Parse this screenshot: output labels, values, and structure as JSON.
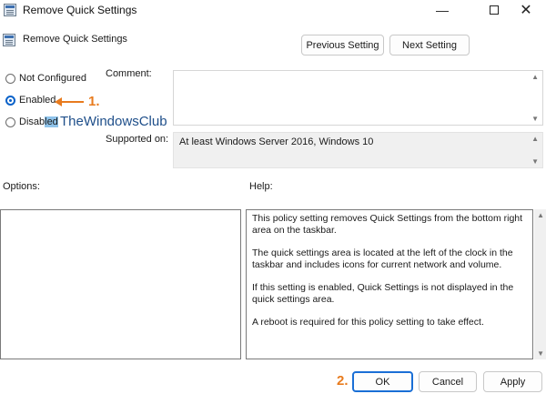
{
  "window": {
    "title": "Remove Quick Settings",
    "minimize_glyph": "—",
    "close_glyph": "✕"
  },
  "header": {
    "policy_name": "Remove Quick Settings",
    "previous_label": "Previous Setting",
    "next_label": "Next Setting"
  },
  "state": {
    "options": [
      {
        "label": "Not Configured",
        "checked": false
      },
      {
        "label": "Enabled",
        "checked": true
      },
      {
        "label_prefix": "Disab",
        "label_highlight": "led",
        "checked": false
      }
    ]
  },
  "annotations": {
    "step1": "1.",
    "step2": "2.",
    "watermark": "TheWindowsClub",
    "accent_color": "#e87b1e"
  },
  "comment": {
    "label": "Comment:",
    "value": ""
  },
  "supported": {
    "label": "Supported on:",
    "value": "At least Windows Server 2016, Windows 10"
  },
  "options_panel": {
    "label": "Options:"
  },
  "help": {
    "label": "Help:",
    "paragraphs": [
      "This policy setting removes Quick Settings from the bottom right area on the taskbar.",
      "The quick settings area is located at the left of the clock in the taskbar and includes icons for current network and volume.",
      "If this setting is enabled, Quick Settings is not displayed in the quick settings area.",
      "A reboot is required for this policy setting to take effect."
    ]
  },
  "footer": {
    "ok_label": "OK",
    "cancel_label": "Cancel",
    "apply_label": "Apply"
  }
}
